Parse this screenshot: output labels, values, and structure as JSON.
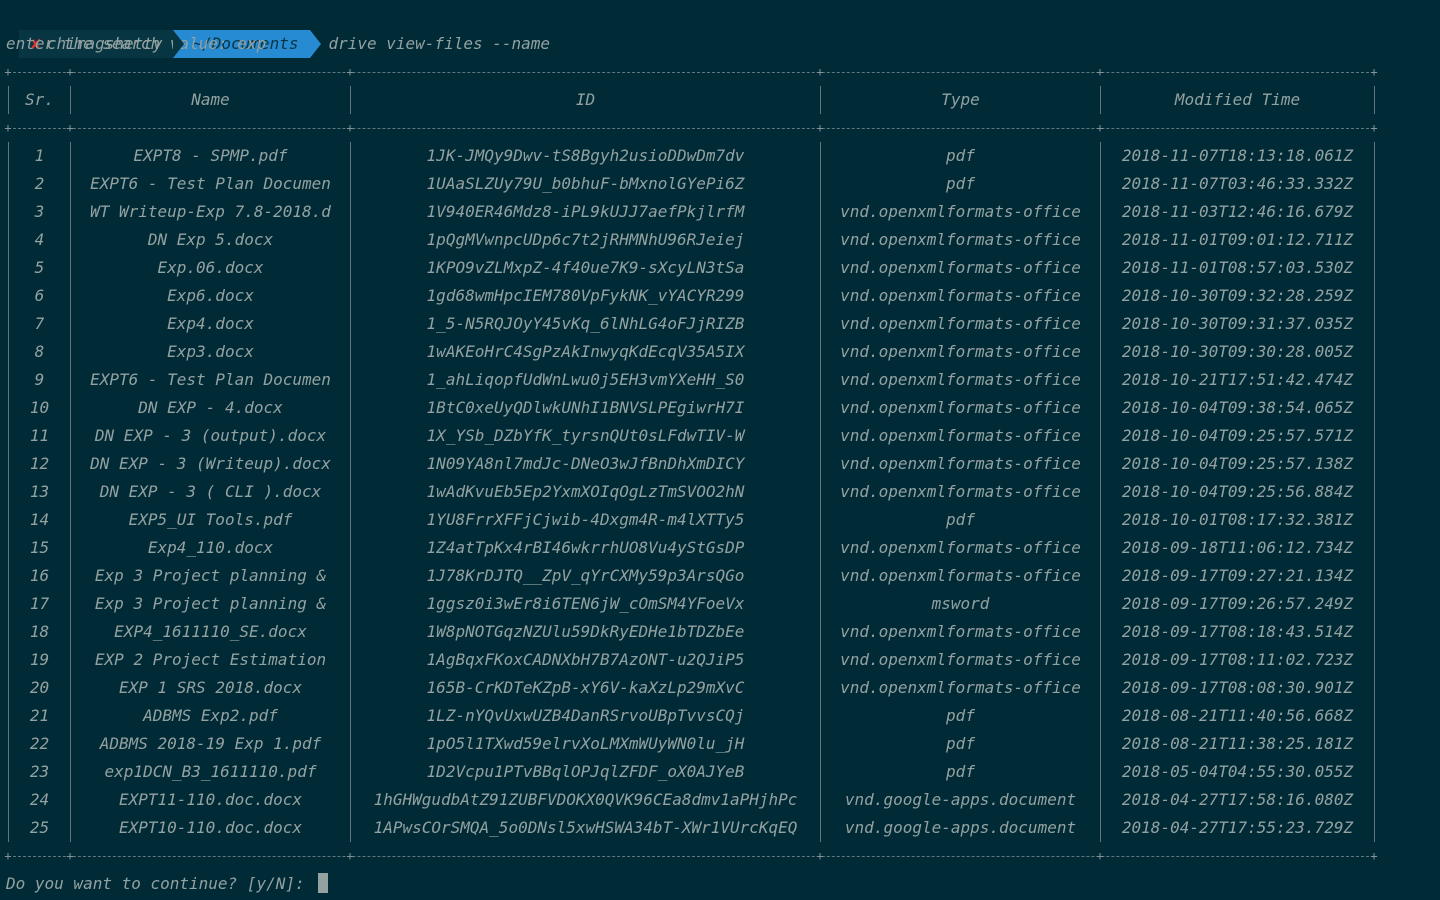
{
  "prompt": {
    "status_icon": "✘",
    "user": "chiragshetty",
    "directory": "~/Documents",
    "command": "drive view-files --name"
  },
  "search_prompt": "enter the search value: exp",
  "table": {
    "headers": [
      "Sr.",
      "Name",
      "ID",
      "Type",
      "Modified Time"
    ],
    "rows": [
      [
        "1",
        "EXPT8 - SPMP.pdf",
        "1JK-JMQy9Dwv-tS8Bgyh2usioDDwDm7dv",
        "pdf",
        "2018-11-07T18:13:18.061Z"
      ],
      [
        "2",
        "EXPT6 - Test Plan Documen",
        "1UAaSLZUy79U_b0bhuF-bMxnolGYePi6Z",
        "pdf",
        "2018-11-07T03:46:33.332Z"
      ],
      [
        "3",
        "WT Writeup-Exp 7.8-2018.d",
        "1V940ER46Mdz8-iPL9kUJJ7aefPkjlrfM",
        "vnd.openxmlformats-office",
        "2018-11-03T12:46:16.679Z"
      ],
      [
        "4",
        "DN Exp 5.docx",
        "1pQgMVwnpcUDp6c7t2jRHMNhU96RJeiej",
        "vnd.openxmlformats-office",
        "2018-11-01T09:01:12.711Z"
      ],
      [
        "5",
        "Exp.06.docx",
        "1KPO9vZLMxpZ-4f40ue7K9-sXcyLN3tSa",
        "vnd.openxmlformats-office",
        "2018-11-01T08:57:03.530Z"
      ],
      [
        "6",
        "Exp6.docx",
        "1gd68wmHpcIEM780VpFykNK_vYACYR299",
        "vnd.openxmlformats-office",
        "2018-10-30T09:32:28.259Z"
      ],
      [
        "7",
        "Exp4.docx",
        "1_5-N5RQJOyY45vKq_6lNhLG4oFJjRIZB",
        "vnd.openxmlformats-office",
        "2018-10-30T09:31:37.035Z"
      ],
      [
        "8",
        "Exp3.docx",
        "1wAKEoHrC4SgPzAkInwyqKdEcqV35A5IX",
        "vnd.openxmlformats-office",
        "2018-10-30T09:30:28.005Z"
      ],
      [
        "9",
        "EXPT6 - Test Plan Documen",
        "1_ahLiqopfUdWnLwu0j5EH3vmYXeHH_S0",
        "vnd.openxmlformats-office",
        "2018-10-21T17:51:42.474Z"
      ],
      [
        "10",
        "DN EXP - 4.docx",
        "1BtC0xeUyQDlwkUNhI1BNVSLPEgiwrH7I",
        "vnd.openxmlformats-office",
        "2018-10-04T09:38:54.065Z"
      ],
      [
        "11",
        "DN EXP - 3 (output).docx",
        "1X_YSb_DZbYfK_tyrsnQUt0sLFdwTIV-W",
        "vnd.openxmlformats-office",
        "2018-10-04T09:25:57.571Z"
      ],
      [
        "12",
        "DN EXP - 3 (Writeup).docx",
        "1N09YA8nl7mdJc-DNeO3wJfBnDhXmDICY",
        "vnd.openxmlformats-office",
        "2018-10-04T09:25:57.138Z"
      ],
      [
        "13",
        "DN EXP - 3 ( CLI ).docx",
        "1wAdKvuEb5Ep2YxmXOIqOgLzTmSVOO2hN",
        "vnd.openxmlformats-office",
        "2018-10-04T09:25:56.884Z"
      ],
      [
        "14",
        "EXP5_UI Tools.pdf",
        "1YU8FrrXFFjCjwib-4Dxgm4R-m4lXTTy5",
        "pdf",
        "2018-10-01T08:17:32.381Z"
      ],
      [
        "15",
        "Exp4_110.docx",
        "1Z4atTpKx4rBI46wkrrhUO8Vu4yStGsDP",
        "vnd.openxmlformats-office",
        "2018-09-18T11:06:12.734Z"
      ],
      [
        "16",
        "Exp 3 Project planning &",
        "1J78KrDJTQ__ZpV_qYrCXMy59p3ArsQGo",
        "vnd.openxmlformats-office",
        "2018-09-17T09:27:21.134Z"
      ],
      [
        "17",
        "Exp 3 Project planning &",
        "1ggsz0i3wEr8i6TEN6jW_cOmSM4YFoeVx",
        "msword",
        "2018-09-17T09:26:57.249Z"
      ],
      [
        "18",
        "EXP4_1611110_SE.docx",
        "1W8pNOTGqzNZUlu59DkRyEDHe1bTDZbEe",
        "vnd.openxmlformats-office",
        "2018-09-17T08:18:43.514Z"
      ],
      [
        "19",
        "EXP 2 Project Estimation",
        "1AgBqxFKoxCADNXbH7B7AzONT-u2QJiP5",
        "vnd.openxmlformats-office",
        "2018-09-17T08:11:02.723Z"
      ],
      [
        "20",
        "EXP 1 SRS 2018.docx",
        "165B-CrKDTeKZpB-xY6V-kaXzLp29mXvC",
        "vnd.openxmlformats-office",
        "2018-09-17T08:08:30.901Z"
      ],
      [
        "21",
        "ADBMS Exp2.pdf",
        "1LZ-nYQvUxwUZB4DanRSrvoUBpTvvsCQj",
        "pdf",
        "2018-08-21T11:40:56.668Z"
      ],
      [
        "22",
        "ADBMS 2018-19 Exp 1.pdf",
        "1pO5l1TXwd59elrvXoLMXmWUyWN0lu_jH",
        "pdf",
        "2018-08-21T11:38:25.181Z"
      ],
      [
        "23",
        "exp1DCN_B3_1611110.pdf",
        "1D2Vcpu1PTvBBqlOPJqlZFDF_oX0AJYeB",
        "pdf",
        "2018-05-04T04:55:30.055Z"
      ],
      [
        "24",
        "EXPT11-110.doc.docx",
        "1hGHWgudbAtZ91ZUBFVDOKX0QVK96CEa8dmv1aPHjhPc",
        "vnd.google-apps.document",
        "2018-04-27T17:58:16.080Z"
      ],
      [
        "25",
        "EXPT10-110.doc.docx",
        "1APwsCOrSMQA_5o0DNsl5xwHSWA34bT-XWr1VUrcKqEQ",
        "vnd.google-apps.document",
        "2018-04-27T17:55:23.729Z"
      ]
    ]
  },
  "continue_prompt": "Do you want to continue? [y/N]: ",
  "colors": {
    "background": "#002b36",
    "text": "#93a1a1",
    "directory_segment": "#268bd2",
    "user_segment": "#073642",
    "error": "#dc322f"
  }
}
